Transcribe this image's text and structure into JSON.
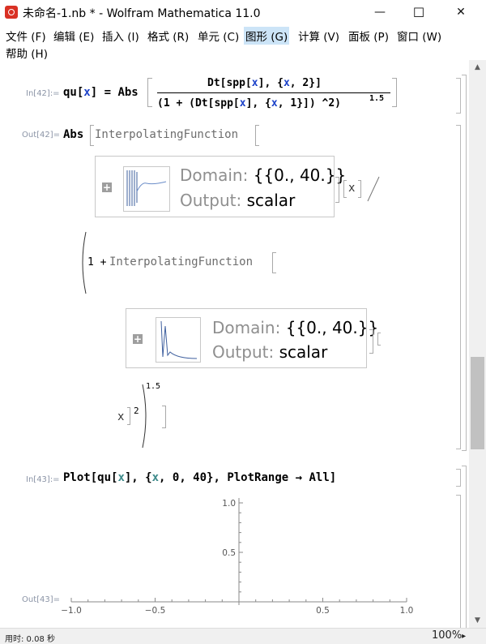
{
  "window": {
    "title": "未命名-1.nb * - Wolfram Mathematica 11.0",
    "minimize_glyph": "—",
    "maximize_glyph": "☐",
    "close_glyph": "✕"
  },
  "menu": [
    {
      "label": "文件 (F)"
    },
    {
      "label": "编辑 (E)"
    },
    {
      "label": "插入 (I)"
    },
    {
      "label": "格式 (R)"
    },
    {
      "label": "单元 (C)"
    },
    {
      "label": "图形 (G)"
    },
    {
      "label": "计算 (V)"
    },
    {
      "label": "面板 (P)"
    },
    {
      "label": "窗口 (W)"
    },
    {
      "label": "帮助 (H)"
    }
  ],
  "cells": {
    "in42": {
      "label": "In[42]:=",
      "lhs_func": "qu[",
      "lhs_var": "x",
      "lhs_close": "] = Abs",
      "num_a": "Dt[spp[",
      "num_x1": "x",
      "num_b": "], {",
      "num_x2": "x",
      "num_c": ", 2}]",
      "den_a": "(1 + (Dt[spp[",
      "den_x1": "x",
      "den_b": "], {",
      "den_x2": "x",
      "den_c": ", 1}]) ^2)",
      "den_exp": "1.5"
    },
    "out42": {
      "label": "Out[42]=",
      "abs": "Abs",
      "if_name": "InterpolatingFunction",
      "arg_x": "x",
      "one_plus": "1 + ",
      "exp": "1.5",
      "sq_exp": "2",
      "box1": {
        "domain_key": "Domain: ",
        "domain_val": "{{0., 40.}}",
        "output_key": "Output: ",
        "output_val": "scalar"
      },
      "box2": {
        "domain_key": "Domain: ",
        "domain_val": "{{0., 40.}}",
        "output_key": "Output: ",
        "output_val": "scalar"
      }
    },
    "in43": {
      "label": "In[43]:=",
      "code_a": "Plot[qu[",
      "code_x1": "x",
      "code_b": "], {",
      "code_x2": "x",
      "code_c": ", 0, 40}, PlotRange → All]"
    },
    "out43": {
      "label": "Out[43]="
    }
  },
  "chart_data": {
    "type": "line",
    "title": "",
    "xlabel": "",
    "ylabel": "",
    "xlim": [
      -1.0,
      1.0
    ],
    "ylim": [
      0,
      1.0
    ],
    "x_ticks": [
      "-1.0",
      "-0.5",
      "0.5",
      "1.0"
    ],
    "y_ticks": [
      "0.5",
      "1.0"
    ],
    "series": []
  },
  "status": {
    "timing": "用时: 0.08 秒",
    "zoom": "100%",
    "zoom_arrow": "▸"
  },
  "scrollbar": {
    "up_glyph": "▲",
    "down_glyph": "▼"
  }
}
